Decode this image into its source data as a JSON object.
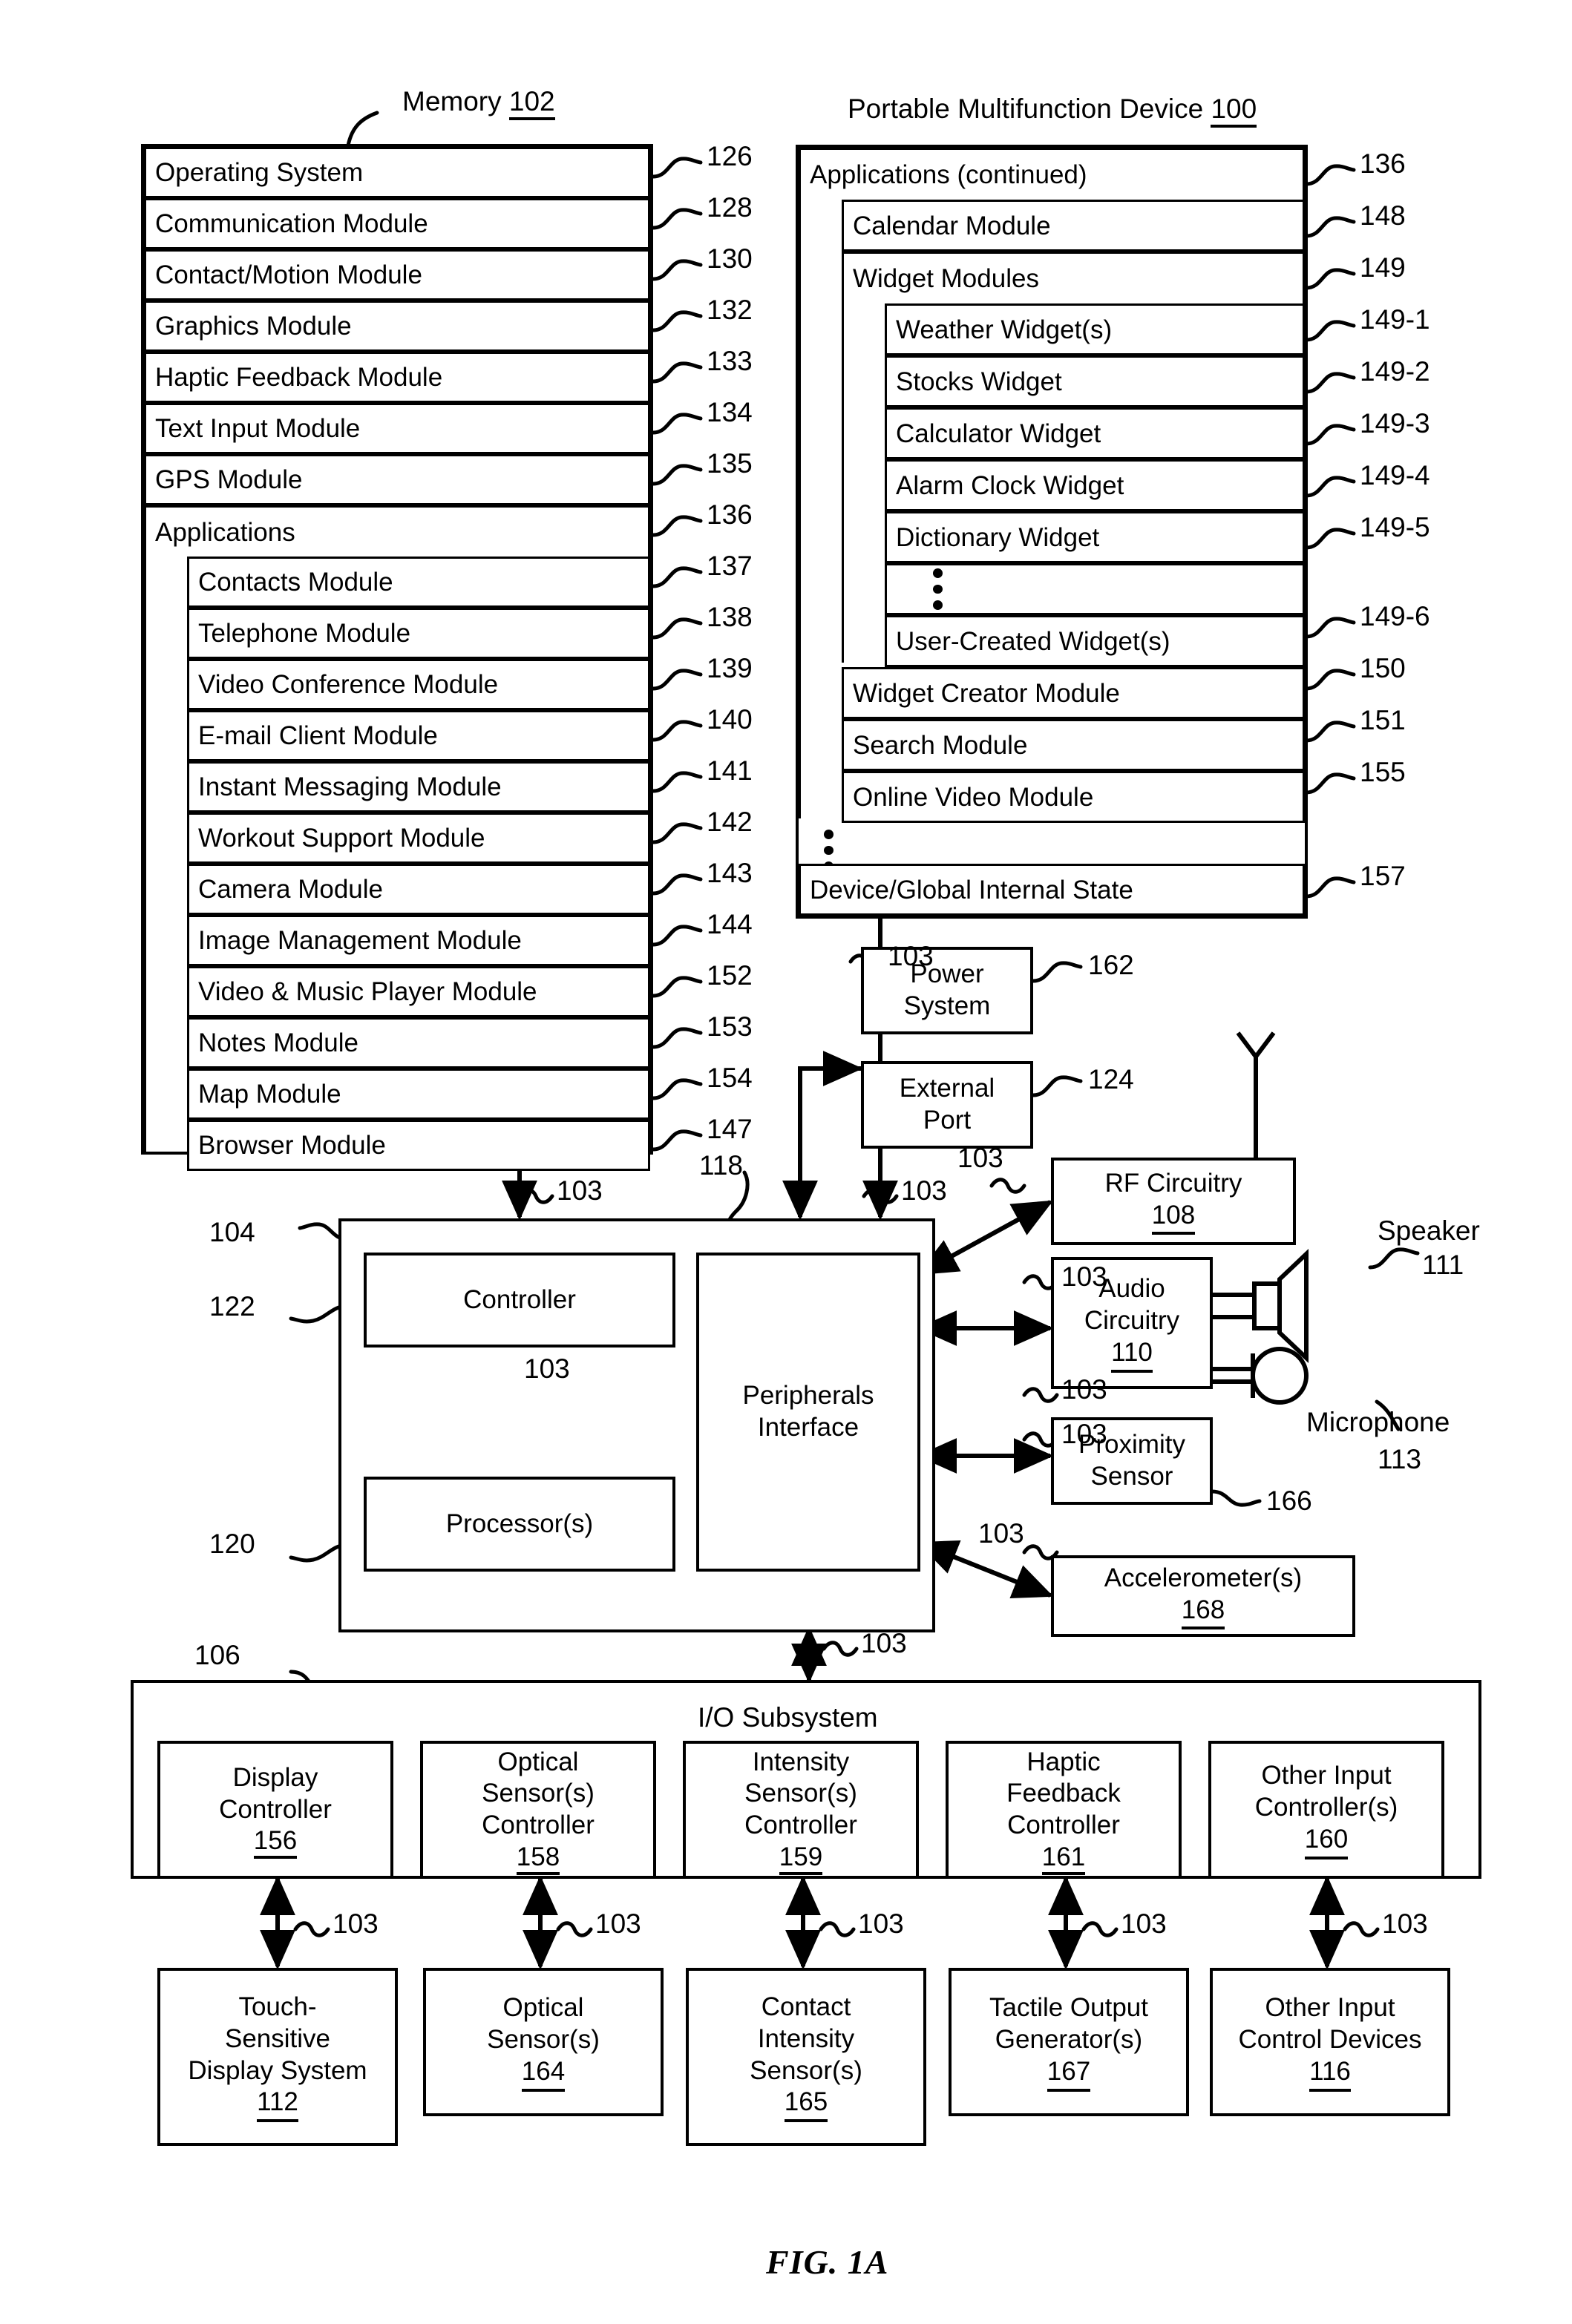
{
  "figure": {
    "caption": "FIG. 1A"
  },
  "memory_panel": {
    "title_text": "Memory",
    "title_ref": "102",
    "rows": [
      {
        "label": "Operating System",
        "ref": "126"
      },
      {
        "label": "Communication Module",
        "ref": "128"
      },
      {
        "label": "Contact/Motion Module",
        "ref": "130"
      },
      {
        "label": "Graphics Module",
        "ref": "132"
      },
      {
        "label": "Haptic Feedback Module",
        "ref": "133"
      },
      {
        "label": "Text Input Module",
        "ref": "134"
      },
      {
        "label": "GPS Module",
        "ref": "135"
      },
      {
        "label": "Applications",
        "ref": "136"
      }
    ],
    "applications": [
      {
        "label": "Contacts Module",
        "ref": "137"
      },
      {
        "label": "Telephone Module",
        "ref": "138"
      },
      {
        "label": "Video Conference Module",
        "ref": "139"
      },
      {
        "label": "E-mail Client Module",
        "ref": "140"
      },
      {
        "label": "Instant Messaging Module",
        "ref": "141"
      },
      {
        "label": "Workout Support Module",
        "ref": "142"
      },
      {
        "label": "Camera Module",
        "ref": "143"
      },
      {
        "label": "Image Management Module",
        "ref": "144"
      },
      {
        "label": "Video & Music Player Module",
        "ref": "152"
      },
      {
        "label": "Notes Module",
        "ref": "153"
      },
      {
        "label": "Map Module",
        "ref": "154"
      },
      {
        "label": "Browser Module",
        "ref": "147"
      }
    ]
  },
  "device_panel": {
    "title_text": "Portable Multifunction Device",
    "title_ref": "100",
    "applications_continued": {
      "label": "Applications (continued)",
      "ref": "136"
    },
    "calendar": {
      "label": "Calendar Module",
      "ref": "148"
    },
    "widget_modules": {
      "label": "Widget Modules",
      "ref": "149"
    },
    "widgets": [
      {
        "label": "Weather Widget(s)",
        "ref": "149-1"
      },
      {
        "label": "Stocks Widget",
        "ref": "149-2"
      },
      {
        "label": "Calculator Widget",
        "ref": "149-3"
      },
      {
        "label": "Alarm Clock Widget",
        "ref": "149-4"
      },
      {
        "label": "Dictionary Widget",
        "ref": "149-5"
      },
      {
        "label": "",
        "ref": ""
      },
      {
        "label": "User-Created Widget(s)",
        "ref": "149-6"
      }
    ],
    "more_modules": [
      {
        "label": "Widget Creator Module",
        "ref": "150"
      },
      {
        "label": "Search Module",
        "ref": "151"
      },
      {
        "label": "Online Video Module",
        "ref": "155"
      }
    ],
    "global_state": {
      "label": "Device/Global Internal State",
      "ref": "157"
    }
  },
  "blocks": {
    "power_system": {
      "lines": [
        "Power",
        "System"
      ],
      "ref": "162"
    },
    "external_port": {
      "lines": [
        "External",
        "Port"
      ],
      "ref": "124"
    },
    "rf_circuitry": {
      "lines": [
        "RF Circuitry"
      ],
      "ref": "108"
    },
    "audio_circuitry": {
      "lines": [
        "Audio",
        "Circuitry"
      ],
      "ref": "110"
    },
    "proximity_sensor": {
      "lines": [
        "Proximity",
        "Sensor"
      ],
      "ref": "166"
    },
    "accelerometers": {
      "lines": [
        "Accelerometer(s)"
      ],
      "ref": "168"
    },
    "controller": {
      "lines": [
        "Controller"
      ],
      "ref": "122"
    },
    "processors": {
      "lines": [
        "Processor(s)"
      ],
      "ref": "120"
    },
    "peripherals_interface": {
      "lines": [
        "Peripherals",
        "Interface"
      ],
      "ref": "118"
    },
    "cpu_group_ref": "104",
    "speaker": {
      "label": "Speaker",
      "ref": "111"
    },
    "microphone": {
      "label": "Microphone",
      "ref": "113"
    }
  },
  "io_subsystem": {
    "label": "I/O Subsystem",
    "ref": "106",
    "controllers": [
      {
        "lines": [
          "Display",
          "Controller"
        ],
        "ref": "156"
      },
      {
        "lines": [
          "Optical",
          "Sensor(s)",
          "Controller"
        ],
        "ref": "158"
      },
      {
        "lines": [
          "Intensity",
          "Sensor(s)",
          "Controller"
        ],
        "ref": "159"
      },
      {
        "lines": [
          "Haptic",
          "Feedback",
          "Controller"
        ],
        "ref": "161"
      },
      {
        "lines": [
          "Other Input",
          "Controller(s)"
        ],
        "ref": "160"
      }
    ],
    "devices": [
      {
        "lines": [
          "Touch-",
          "Sensitive",
          "Display System"
        ],
        "ref": "112"
      },
      {
        "lines": [
          "Optical",
          "Sensor(s)"
        ],
        "ref": "164"
      },
      {
        "lines": [
          "Contact",
          "Intensity",
          "Sensor(s)"
        ],
        "ref": "165"
      },
      {
        "lines": [
          "Tactile Output",
          "Generator(s)"
        ],
        "ref": "167"
      },
      {
        "lines": [
          "Other Input",
          "Control Devices"
        ],
        "ref": "116"
      }
    ]
  },
  "bus_labels": {
    "bus": "103",
    "instances": [
      "103",
      "103",
      "103",
      "103",
      "103",
      "103",
      "103",
      "103",
      "103",
      "103",
      "103",
      "103",
      "103",
      "103",
      "103"
    ]
  },
  "colors": {
    "ink": "#000000",
    "paper": "#ffffff"
  }
}
